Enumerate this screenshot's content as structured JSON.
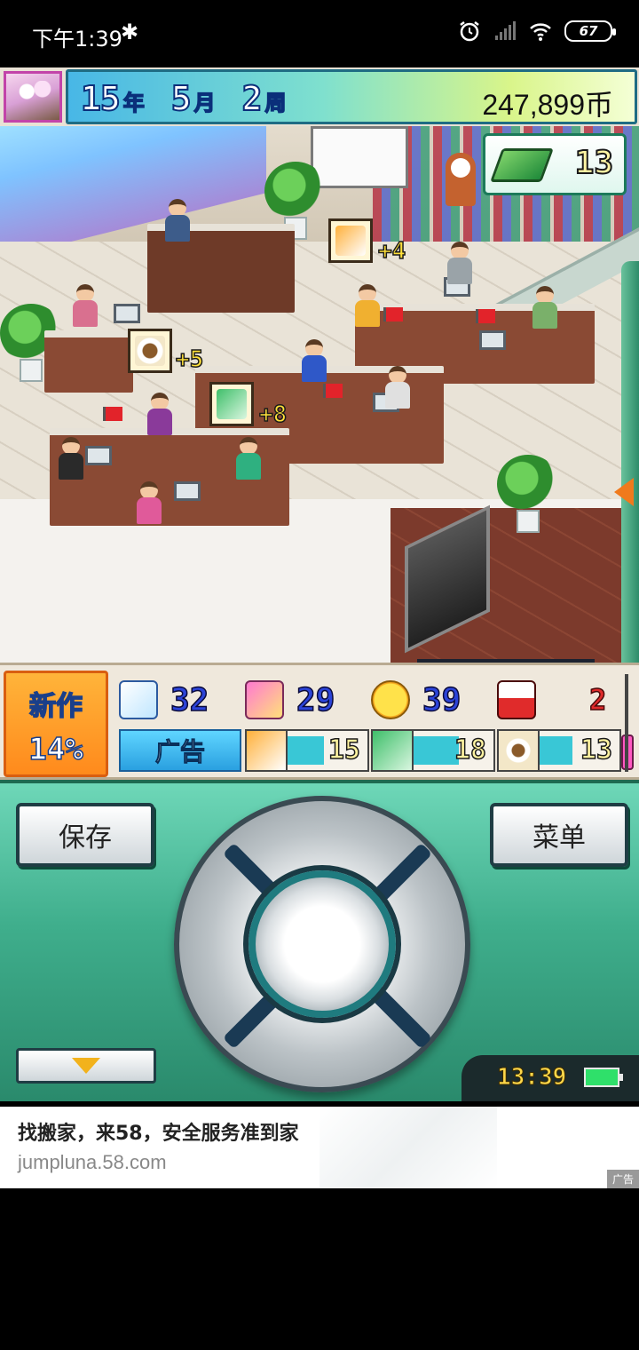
{
  "status_bar": {
    "time": "下午1:39",
    "bluetooth_icon": "bluetooth-icon",
    "alarm_icon": "alarm-icon",
    "signal_icon": "signal-icon",
    "wifi_icon": "wifi-icon",
    "battery": "67"
  },
  "hud": {
    "year": "15",
    "year_unit": "年",
    "month": "5",
    "month_unit": "月",
    "week": "2",
    "week_unit": "周",
    "money": "247,899币"
  },
  "scene": {
    "research_points": "13",
    "bubbles": [
      {
        "icon": "editing-icon",
        "plus": "+4"
      },
      {
        "icon": "coffee-icon",
        "plus": "+5"
      },
      {
        "icon": "music-icon",
        "plus": "+8"
      }
    ]
  },
  "stats": {
    "new_work_label": "新作",
    "new_work_progress": "14%",
    "fun": "32",
    "creativity": "29",
    "graphics": "39",
    "bugs": "2",
    "ad_label": "广告",
    "meters": [
      {
        "icon": "editing-icon",
        "value": "15",
        "fill": 0.45
      },
      {
        "icon": "music-icon",
        "value": "18",
        "fill": 0.55
      },
      {
        "icon": "coffee-icon",
        "value": "13",
        "fill": 0.4
      }
    ]
  },
  "controller": {
    "save_label": "保存",
    "menu_label": "菜单",
    "clock": "13:39"
  },
  "ad": {
    "title": "找搬家，来58，安全服务准到家",
    "url": "jumpluna.58.com",
    "tag": "广告"
  },
  "colors": {
    "controller_green": "#3fae8c",
    "stat_blue": "#2c44d8",
    "bug_red": "#e02b2b",
    "new_work_orange": "#ff8a1c"
  }
}
